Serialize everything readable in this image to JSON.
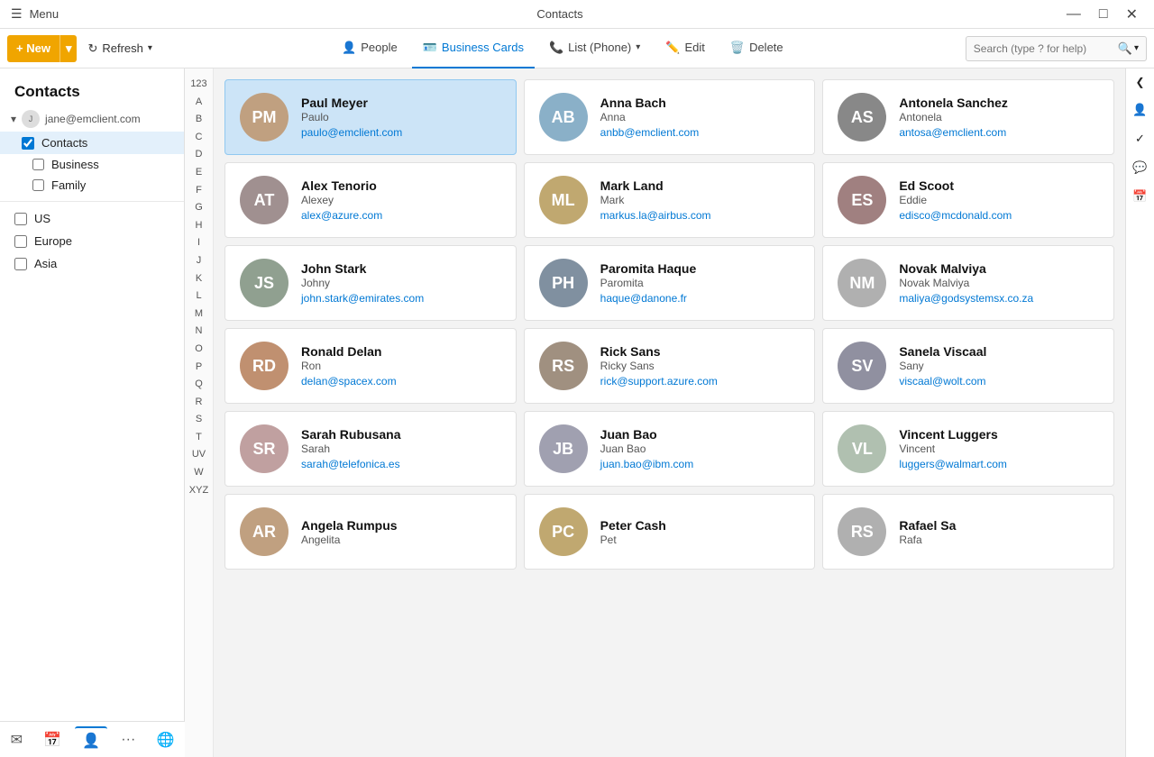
{
  "app": {
    "title": "Contacts",
    "menu_label": "Menu"
  },
  "titlebar": {
    "minimize": "—",
    "maximize": "□",
    "close": "✕"
  },
  "toolbar": {
    "new_label": "+ New",
    "new_arrow": "▾",
    "refresh_label": "Refresh",
    "refresh_arrow": "▾",
    "search_placeholder": "Search (type ? for help)",
    "search_icon": "🔍"
  },
  "tabs": [
    {
      "id": "people",
      "label": "People",
      "icon": "👤",
      "active": false
    },
    {
      "id": "business-cards",
      "label": "Business Cards",
      "icon": "🪪",
      "active": true
    },
    {
      "id": "list-phone",
      "label": "List (Phone)",
      "icon": "📞",
      "active": false,
      "arrow": "▾"
    },
    {
      "id": "edit",
      "label": "Edit",
      "icon": "✏️",
      "active": false
    },
    {
      "id": "delete",
      "label": "Delete",
      "icon": "🗑️",
      "active": false
    }
  ],
  "sidebar": {
    "title": "Contacts",
    "account": {
      "email": "jane@emclient.com",
      "caret": "▾"
    },
    "contacts_label": "Contacts",
    "sub_items": [
      {
        "label": "Business",
        "checked": false
      },
      {
        "label": "Family",
        "checked": false
      }
    ],
    "groups": [
      {
        "label": "US",
        "checked": false
      },
      {
        "label": "Europe",
        "checked": false
      },
      {
        "label": "Asia",
        "checked": false
      }
    ]
  },
  "alpha_index": [
    "123",
    "A",
    "B",
    "C",
    "D",
    "E",
    "F",
    "G",
    "H",
    "I",
    "J",
    "K",
    "L",
    "M",
    "N",
    "O",
    "P",
    "Q",
    "R",
    "S",
    "T",
    "UV",
    "W",
    "XYZ"
  ],
  "contacts": [
    {
      "id": 1,
      "name": "Paul Meyer",
      "nick": "Paulo",
      "email": "paulo@emclient.com",
      "av": "av-1",
      "selected": true
    },
    {
      "id": 2,
      "name": "Anna Bach",
      "nick": "Anna",
      "email": "anbb@emclient.com",
      "av": "av-2",
      "selected": false
    },
    {
      "id": 3,
      "name": "Antonela Sanchez",
      "nick": "Antonela",
      "email": "antosa@emclient.com",
      "av": "av-3",
      "selected": false
    },
    {
      "id": 4,
      "name": "Alex Tenorio",
      "nick": "Alexey",
      "email": "alex@azure.com",
      "av": "av-4",
      "selected": false
    },
    {
      "id": 5,
      "name": "Mark Land",
      "nick": "Mark",
      "email": "markus.la@airbus.com",
      "av": "av-5",
      "selected": false
    },
    {
      "id": 6,
      "name": "Ed Scoot",
      "nick": "Eddie",
      "email": "edisco@mcdonald.com",
      "av": "av-6",
      "selected": false
    },
    {
      "id": 7,
      "name": "John Stark",
      "nick": "Johny",
      "email": "john.stark@emirates.com",
      "av": "av-7",
      "selected": false
    },
    {
      "id": 8,
      "name": "Paromita Haque",
      "nick": "Paromita",
      "email": "haque@danone.fr",
      "av": "av-8",
      "selected": false
    },
    {
      "id": 9,
      "name": "Novak Malviya",
      "nick": "Novak Malviya",
      "email": "maliya@godsystemsx.co.za",
      "av": "av-9",
      "selected": false
    },
    {
      "id": 10,
      "name": "Ronald Delan",
      "nick": "Ron",
      "email": "delan@spacex.com",
      "av": "av-10",
      "selected": false
    },
    {
      "id": 11,
      "name": "Rick Sans",
      "nick": "Ricky Sans",
      "email": "rick@support.azure.com",
      "av": "av-11",
      "selected": false
    },
    {
      "id": 12,
      "name": "Sanela Viscaal",
      "nick": "Sany",
      "email": "viscaal@wolt.com",
      "av": "av-12",
      "selected": false
    },
    {
      "id": 13,
      "name": "Sarah Rubusana",
      "nick": "Sarah",
      "email": "sarah@telefonica.es",
      "av": "av-13",
      "selected": false
    },
    {
      "id": 14,
      "name": "Juan Bao",
      "nick": "Juan Bao",
      "email": "juan.bao@ibm.com",
      "av": "av-14",
      "selected": false
    },
    {
      "id": 15,
      "name": "Vincent Luggers",
      "nick": "Vincent",
      "email": "luggers@walmart.com",
      "av": "av-15",
      "selected": false
    },
    {
      "id": 16,
      "name": "Angela Rumpus",
      "nick": "Angelita",
      "email": "",
      "av": "av-1",
      "selected": false
    },
    {
      "id": 17,
      "name": "Peter Cash",
      "nick": "Pet",
      "email": "",
      "av": "av-5",
      "selected": false
    },
    {
      "id": 18,
      "name": "Rafael Sa",
      "nick": "Rafa",
      "email": "",
      "av": "av-9",
      "selected": false
    }
  ],
  "right_sidebar": {
    "person_icon": "👤",
    "check_icon": "✓",
    "chat_icon": "💬",
    "calendar_icon": "📅",
    "collapse_icon": "❮"
  },
  "bottom_nav": {
    "mail_icon": "✉",
    "calendar_icon": "📅",
    "contacts_icon": "👤",
    "more_icon": "···",
    "globe_icon": "🌐"
  }
}
